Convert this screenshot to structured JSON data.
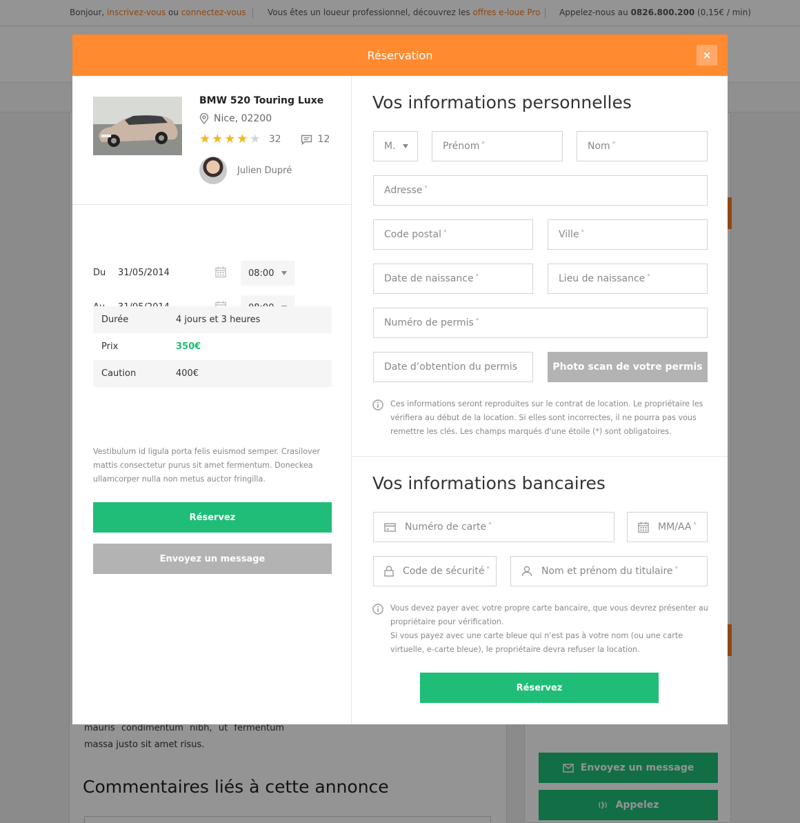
{
  "topbar": {
    "bonjour": "Bonjour,",
    "signup": "inscrivez-vous",
    "ou": "ou",
    "login": "connectez-vous",
    "pro_text": "Vous êtes un loueur professionnel, découvrez les",
    "pro_link": "offres e-loue Pro",
    "call_text": "Appelez-nous au",
    "phone": "0826.800.200",
    "phone_price": "(0,15€ / min)"
  },
  "background": {
    "text": "mauris condimentum nibh, ut fermentum massa justo sit amet risus.",
    "comments_title": "Commentaires liés à cette annonce",
    "sidebar_message_btn": "Envoyez un message",
    "sidebar_call_btn": "Appelez"
  },
  "modal": {
    "title": "Réservation",
    "close_label": "×"
  },
  "listing": {
    "title": "BMW 520 Touring Luxe",
    "location": "Nice, 02200",
    "rating": 4,
    "rating_max": 5,
    "reviews_count": "32",
    "comments_count": "12",
    "owner_name": "Julien Dupré"
  },
  "booking": {
    "from_label": "Du",
    "from_date": "31/05/2014",
    "from_time": "08:00",
    "to_label": "Au",
    "to_date": "31/05/2014",
    "to_time": "08:00",
    "summary": [
      {
        "key": "Durée",
        "value": "4 jours et 3 heures"
      },
      {
        "key": "Prix",
        "value": "350€"
      },
      {
        "key": "Caution",
        "value": "400€"
      }
    ],
    "description": "Vestibulum id ligula porta felis euismod semper. Crasilover mattis consectetur purus sit amet fermentum. Doneckea ullamcorper nulla non metus auctor fringilla.",
    "reserve_btn": "Réservez",
    "message_btn": "Envoyez un message"
  },
  "personal": {
    "title": "Vos informations personnelles",
    "civility": "M.",
    "firstname": "Prénom",
    "lastname": "Nom",
    "address": "Adresse",
    "postcode": "Code postal",
    "city": "Ville",
    "birthdate": "Date de naissance",
    "birthplace": "Lieu de naissance",
    "license_number": "Numéro de permis",
    "license_date": "Date d’obtention du permis",
    "license_scan_btn": "Photo scan de votre permis",
    "required_mark": "*",
    "note": "Ces informations seront reproduites sur le contrat de location. Le propriétaire les vérifiera au début de la location. Si elles sont incorrectes, il ne pourra pas vous remettre les clés. Les champs marqués d'une étoile (*) sont obligatoires."
  },
  "banking": {
    "title": "Vos informations bancaires",
    "card_number": "Numéro de carte",
    "expiry": "MM/AA",
    "cvv": "Code de sécurité",
    "holder": "Nom et prénom du titulaire",
    "note_1": "Vous devez payer avec votre propre carte bancaire, que vous devrez présenter au propriétaire pour vérification.",
    "note_2": "Si vous payez avec une carte bleue qui n'est pas à votre nom (ou une carte virtuelle, e-carte bleue), le propriétaire devra refuser la location.",
    "reserve_btn": "Réservez"
  },
  "colors": {
    "accent_orange": "#ff8a2f",
    "accent_green": "#1fbd77",
    "button_grey": "#b3b3b3"
  }
}
